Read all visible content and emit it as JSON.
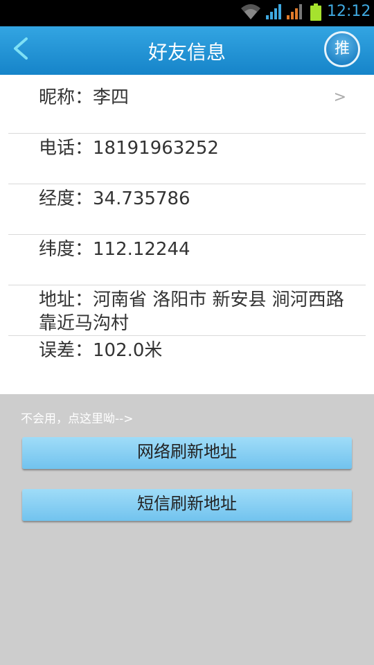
{
  "status_bar": {
    "time": "12:12"
  },
  "header": {
    "title": "好友信息",
    "push_label": "推"
  },
  "info": {
    "nickname": "昵称：李四",
    "phone": "电话：18191963252",
    "longitude": "经度：34.735786",
    "latitude": "纬度：112.12244",
    "address": "地址：河南省 洛阳市 新安县 涧河西路 靠近马沟村",
    "error": "误差：102.0米",
    "chevron": ">"
  },
  "help_hint": "不会用，点这里呦-->",
  "buttons": {
    "network_refresh": "网络刷新地址",
    "sms_refresh": "短信刷新地址"
  }
}
